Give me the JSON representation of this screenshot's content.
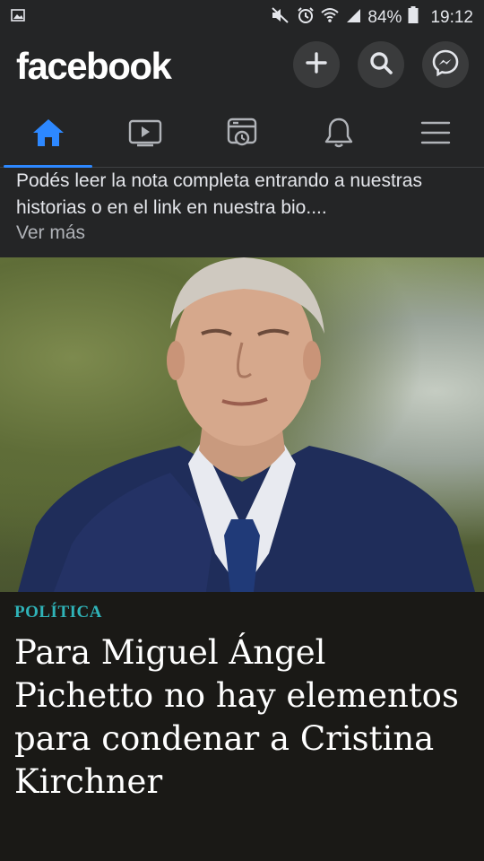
{
  "status_bar": {
    "battery": "84%",
    "time": "19:12",
    "icons": [
      "image-icon",
      "mute-icon",
      "alarm-icon",
      "wifi-icon",
      "signal-icon",
      "battery-icon"
    ]
  },
  "header": {
    "logo": "facebook",
    "buttons": [
      "plus-icon",
      "search-icon",
      "messenger-icon"
    ]
  },
  "tabs": [
    {
      "name": "home",
      "icon": "home-icon",
      "active": true
    },
    {
      "name": "watch",
      "icon": "video-icon",
      "active": false
    },
    {
      "name": "memories",
      "icon": "memories-icon",
      "active": false
    },
    {
      "name": "notifications",
      "icon": "bell-icon",
      "active": false
    },
    {
      "name": "menu",
      "icon": "menu-icon",
      "active": false
    }
  ],
  "post": {
    "text": "Podés leer la nota completa entrando a nuestras historias o en el link en nuestra bio....",
    "see_more": "Ver más"
  },
  "article": {
    "category": "POLÍTICA",
    "headline": "Para Miguel Ángel Pichetto no hay elementos para condenar a Cristina Kirchner"
  },
  "colors": {
    "accent": "#2d88ff",
    "category": "#2fb3b8",
    "background": "#242526"
  }
}
